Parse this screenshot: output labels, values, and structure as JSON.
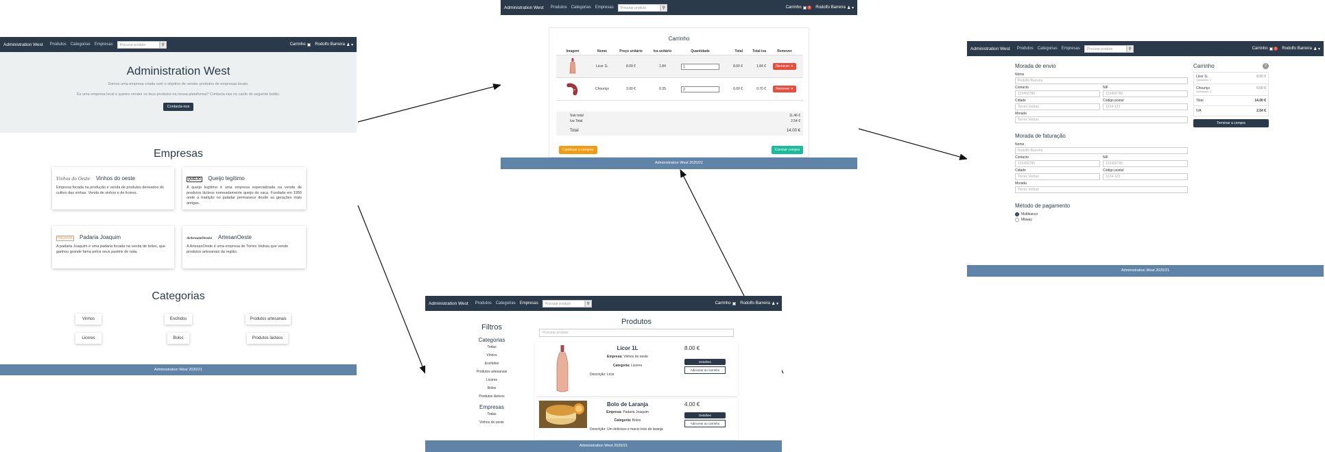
{
  "common": {
    "brand": "Administration West",
    "nav_produtos": "Produtos",
    "nav_categorias": "Categorias",
    "nav_empresas": "Empresas",
    "search_placeholder": "Procurar produto",
    "cart_label": "Carrinho",
    "cart_count": "2",
    "user": "Rodolfo Barreira",
    "footer": "Administration West 2020/21",
    "colors": {
      "navbar": "#2b3a4a",
      "footer": "#5f84a8",
      "danger": "#e74c3c",
      "warning": "#f39c12",
      "success": "#18bc9c"
    }
  },
  "home": {
    "hero_title": "Administration West",
    "hero_sub1": "Somos uma empresa criada com o objetivo de vender produtos de empresas locais.",
    "hero_sub2": "És uma empresa local e queres vender os teus produtos na nossa plataforma? Contacta-nos no canto do seguinte botão:",
    "contact_btn": "Contacta-nos",
    "empresas_title": "Empresas",
    "empresas": [
      {
        "logo": "Vinhos do Oeste",
        "name": "Vinhos do oeste",
        "desc": "Empresa focada na produção e venda de produtos derivados do cultivo das vinhas. Venda de vinhos e de licores."
      },
      {
        "logo": "QUEIJO",
        "name": "Queijo legítimo",
        "desc": "A queijo legítimo é uma empresa especializada na venda de produtos lácteos nomeadamente queijo de vaca. Fundada em 1950 onde a tradição no paladar permanece desde as gerações mais antigas."
      },
      {
        "logo": "PADARIA",
        "name": "Padaria Joaquim",
        "desc": "A padaria Joaquim é uma padaria focada na venda de bolos, que ganhou grande fama pelos seus pastéis de nata."
      },
      {
        "logo": "ArtesanOeste",
        "name": "ArtesanOeste",
        "desc": "A ArtesanOeste é uma empresa de Torres Vedras que vende produtos artesanais da região."
      }
    ],
    "categorias_title": "Categorias",
    "categorias": [
      "Vinhos",
      "Enchidos",
      "Produtos artesanais",
      "Licores",
      "Bolos",
      "Produtos lácteos"
    ]
  },
  "cart": {
    "title": "Carrinho",
    "headers": [
      "Imagem",
      "Nome",
      "Preço unitário",
      "Iva unitário",
      "Quantidade",
      "Total",
      "Total iva",
      "Remover"
    ],
    "rows": [
      {
        "nome": "Licor 1L",
        "preco": "8.00 €",
        "iva": "1.84",
        "qtd": "1",
        "total": "8.00 €",
        "total_iva": "1.84 €",
        "remover": "Remover ✕"
      },
      {
        "nome": "Chouriço",
        "preco": "3.00 €",
        "iva": "0.35",
        "qtd": "2",
        "total": "6.00 €",
        "total_iva": "0.70 €",
        "remover": "Remover ✕"
      }
    ],
    "subtotal_label": "Sub total",
    "subtotal": "11.46 €",
    "iva_label": "Iva Total",
    "iva": "2.54 €",
    "total_label": "Total",
    "total": "14.00 €",
    "continue_btn": "Continuar a comprar",
    "checkout_btn": "Concluir compra"
  },
  "checkout": {
    "envio_title": "Morada de envio",
    "faturacao_title": "Morada de faturação",
    "pagamento_title": "Método de pagamento",
    "label_nome": "Nome",
    "label_contacto": "Contacto",
    "label_nif": "NIF",
    "label_cidade": "Cidade",
    "label_codigo": "Código postal",
    "label_morada": "Morada",
    "val_nome": "Rodolfo Barreira",
    "val_contacto": "123456789",
    "val_nif": "123456789",
    "val_cidade": "Torres Vedras",
    "val_codigo": "1234-123",
    "val_morada": "Torres Vedras",
    "pay_options": [
      "Multibanco",
      "Mbway"
    ],
    "cart_title": "Carrinho",
    "cart_count": "2",
    "items": [
      {
        "name": "Licor 1L",
        "sub": "Quantidade: 1",
        "price": "8.00 €"
      },
      {
        "name": "Chouriço",
        "sub": "Quantidade: 2",
        "price": "6.00 €"
      }
    ],
    "total_label": "Total",
    "total": "14.00 €",
    "iva_label": "IVA",
    "iva": "2.54 €",
    "finish_btn": "Terminar a compra"
  },
  "products": {
    "filters_title": "Filtros",
    "cat_title": "Categorias",
    "cats": [
      "Todas",
      "Vinhos",
      "Enchidos",
      "Produtos artesanais",
      "Licores",
      "Bolos",
      "Produtos lácteos"
    ],
    "emp_title": "Empresas",
    "emps": [
      "Todas",
      "Vinhos do oeste"
    ],
    "title": "Produtos",
    "search_placeholder": "Procurar produto",
    "items": [
      {
        "name": "Licor 1L",
        "empresa_label": "Empresa:",
        "empresa": "Vinhos do oeste",
        "categoria_label": "Categoria:",
        "categoria": "Licores",
        "desc": "Descrição: Licor",
        "price": "8.00 €",
        "detalhes": "Detalhes",
        "adicionar": "Adicionar ao carrinho"
      },
      {
        "name": "Bolo de Laranja",
        "empresa_label": "Empresa:",
        "empresa": "Padaria Joaquim",
        "categoria_label": "Categoria:",
        "categoria": "Bolos",
        "desc": "Descrição: Um delicioso e macio bolo de laranja",
        "price": "4.00 €",
        "detalhes": "Detalhes",
        "adicionar": "Adicionar ao carrinho"
      }
    ]
  }
}
